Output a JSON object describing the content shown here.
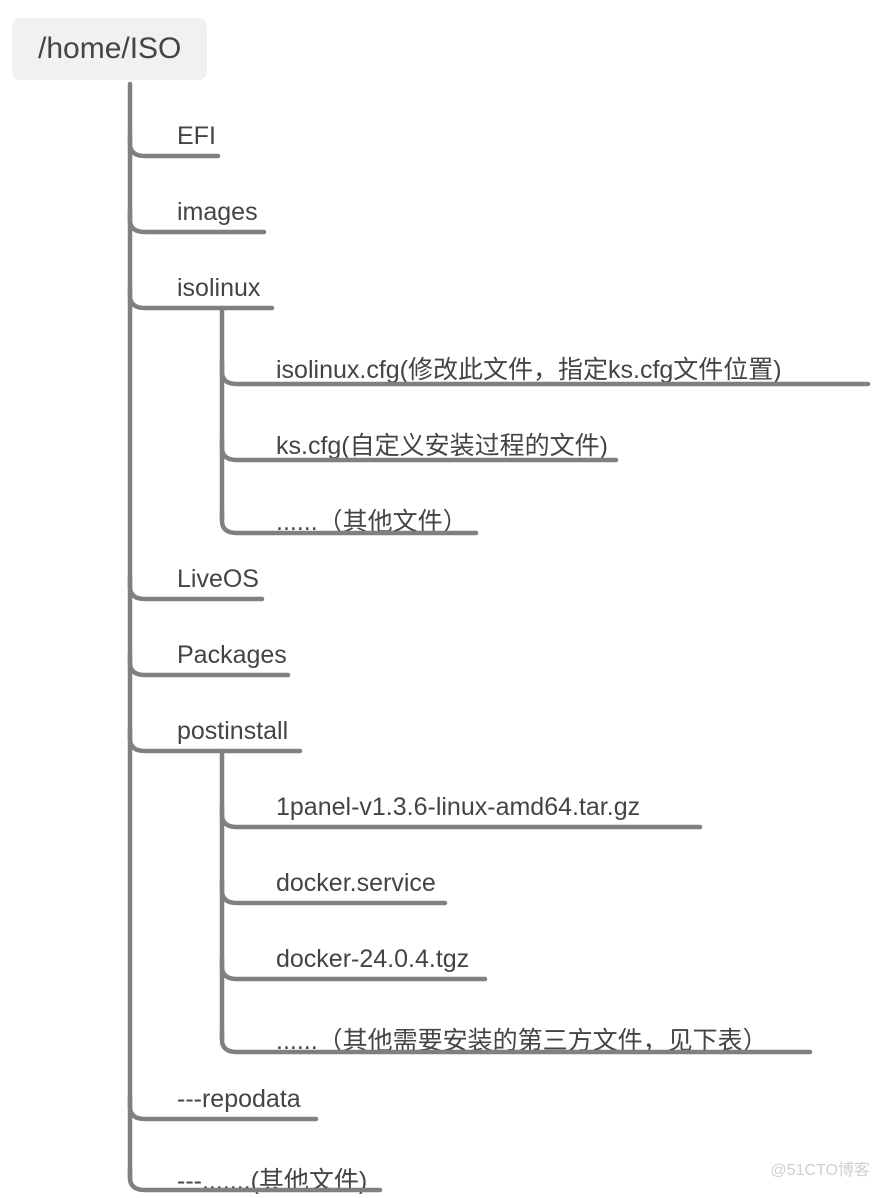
{
  "root": {
    "label": "/home/ISO"
  },
  "level1": {
    "efi": {
      "label": "EFI"
    },
    "images": {
      "label": "images"
    },
    "isolinux": {
      "label": "isolinux"
    },
    "liveos": {
      "label": "LiveOS"
    },
    "packages": {
      "label": "Packages"
    },
    "postinstall": {
      "label": "postinstall"
    },
    "repodata": {
      "label": "---repodata"
    },
    "other": {
      "label": "---.......(其他文件)"
    }
  },
  "isolinux_children": {
    "cfg": {
      "label": "isolinux.cfg(修改此文件，指定ks.cfg文件位置)"
    },
    "ks": {
      "label": "ks.cfg(自定义安装过程的文件)"
    },
    "other": {
      "label": "......（其他文件）"
    }
  },
  "postinstall_children": {
    "panel": {
      "label": "1panel-v1.3.6-linux-amd64.tar.gz"
    },
    "svc": {
      "label": "docker.service"
    },
    "tgz": {
      "label": "docker-24.0.4.tgz"
    },
    "other": {
      "label": "......（其他需要安装的第三方文件，见下表）"
    }
  },
  "watermark": "@51CTO博客",
  "style": {
    "stroke": "#808080",
    "stroke_width": 4.5
  }
}
